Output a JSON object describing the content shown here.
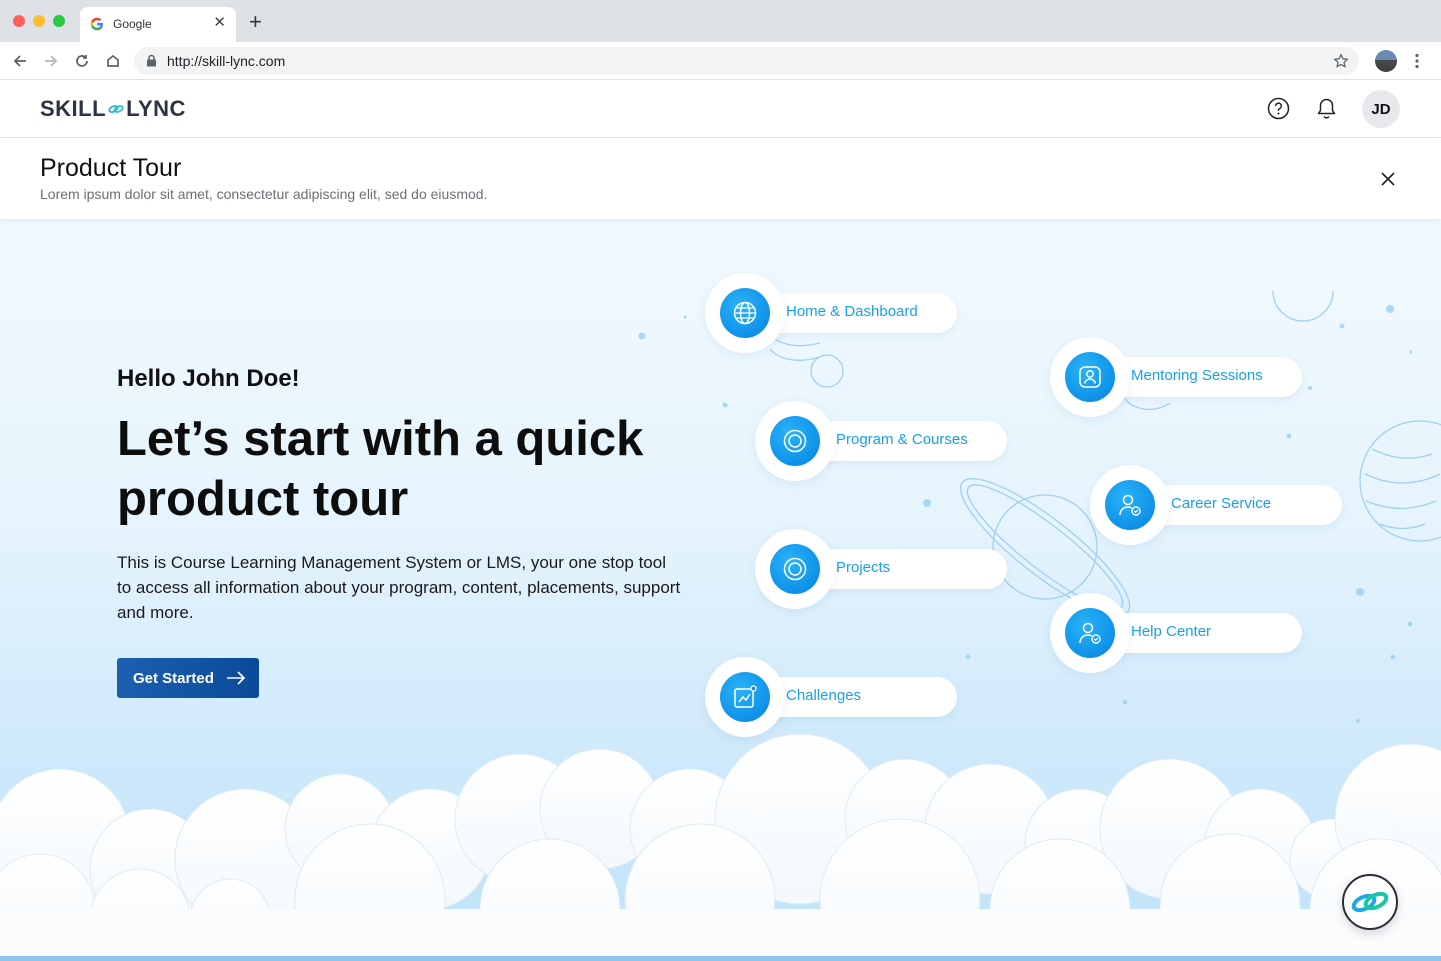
{
  "browser": {
    "tab_title": "Google",
    "new_tab_symbol": "+",
    "url": "http://skill-lync.com"
  },
  "header": {
    "logo_left": "SKILL",
    "logo_right": "LYNC",
    "avatar_initials": "JD"
  },
  "tour": {
    "title": "Product Tour",
    "subtitle": "Lorem ipsum dolor sit amet, consectetur adipiscing elit, sed do eiusmod."
  },
  "hero": {
    "greeting": "Hello John Doe!",
    "headline": "Let’s start with a quick product tour",
    "description": "This is Course Learning Management System or LMS, your one stop tool to access all information about your program, content, placements, support and more.",
    "cta_label": "Get Started"
  },
  "features": [
    {
      "label": "Home & Dashboard",
      "icon": "globe-icon"
    },
    {
      "label": "Mentoring Sessions",
      "icon": "mentor-icon"
    },
    {
      "label": "Program & Courses",
      "icon": "target-icon"
    },
    {
      "label": "Career Service",
      "icon": "career-icon"
    },
    {
      "label": "Projects",
      "icon": "target-icon"
    },
    {
      "label": "Help Center",
      "icon": "help-user-icon"
    },
    {
      "label": "Challenges",
      "icon": "chart-icon"
    }
  ],
  "colors": {
    "accent": "#19a1e8",
    "cta": "#0a4a99",
    "hero_bg": "#e6f4fd"
  }
}
